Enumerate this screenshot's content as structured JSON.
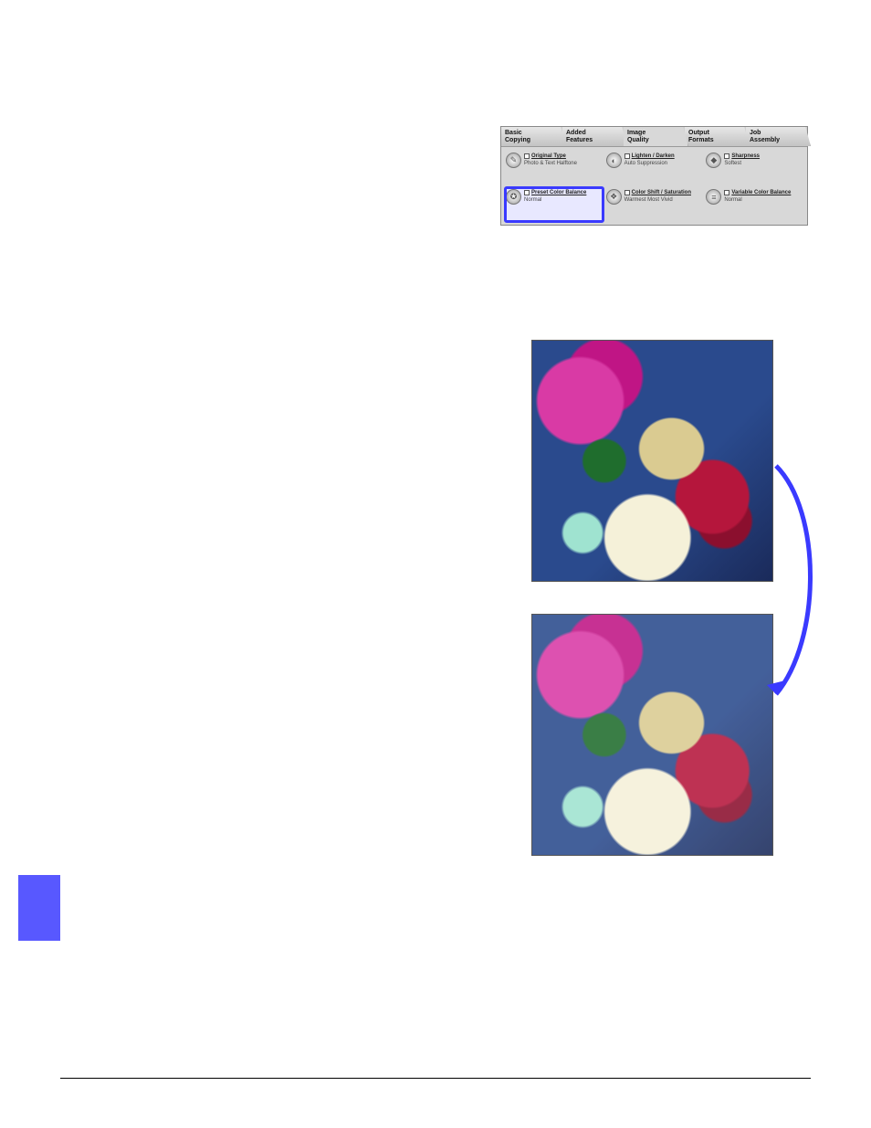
{
  "panel": {
    "tabs": [
      {
        "line1": "Basic",
        "line2": "Copying"
      },
      {
        "line1": "Added",
        "line2": "Features"
      },
      {
        "line1": "Image",
        "line2": "Quality"
      },
      {
        "line1": "Output",
        "line2": "Formats"
      },
      {
        "line1": "Job",
        "line2": "Assembly"
      }
    ],
    "active_tab_index": 2,
    "options": [
      {
        "icon": "original-type-icon",
        "icon_glyph": "✎",
        "title": "Original Type",
        "sub": "Photo & Text Halftone"
      },
      {
        "icon": "lighten-darken-icon",
        "icon_glyph": "◐",
        "title": "Lighten / Darken",
        "sub": "Auto Suppression"
      },
      {
        "icon": "sharpness-icon",
        "icon_glyph": "◆",
        "title": "Sharpness",
        "sub": "Softest"
      },
      {
        "icon": "preset-balance-icon",
        "icon_glyph": "✪",
        "title": "Preset Color Balance",
        "sub": "Normal",
        "highlight": true
      },
      {
        "icon": "color-shift-icon",
        "icon_glyph": "❖",
        "title": "Color Shift / Saturation",
        "sub": "Warmest Most Vivid"
      },
      {
        "icon": "variable-balance-icon",
        "icon_glyph": "≡",
        "title": "Variable Color Balance",
        "sub": "Normal"
      }
    ]
  },
  "colors": {
    "highlight": "#3a3aff",
    "arrow": "#3a3aff",
    "side_tab": "#5858ff"
  }
}
